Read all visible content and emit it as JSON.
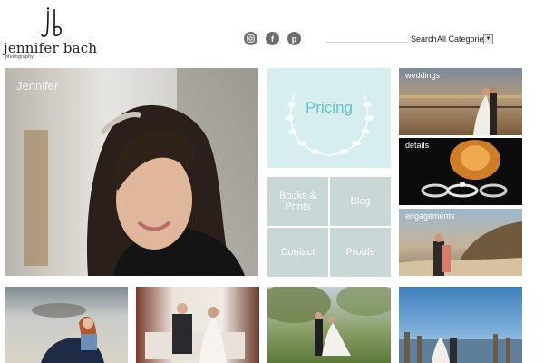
{
  "brand": {
    "monogram": "jb",
    "name": "jennifer bach",
    "tagline": "photography"
  },
  "social": {
    "instagram": "instagram-icon",
    "facebook": "f",
    "pinterest": "p"
  },
  "search": {
    "label": "Search",
    "category": "All Categories"
  },
  "hero": {
    "caption": "Jennifer"
  },
  "pricing": {
    "label": "Pricing"
  },
  "nav": {
    "books_prints": "Books & Prints",
    "blog": "Blog",
    "contact": "Contact",
    "proofs": "Proofs"
  },
  "galleries": {
    "weddings": "weddings",
    "details": "details",
    "engagements": "engagements"
  },
  "colors": {
    "accent": "#5ec4c7",
    "pricing_bg": "#d7eeee",
    "nav_bg": "#c9d7d7"
  }
}
